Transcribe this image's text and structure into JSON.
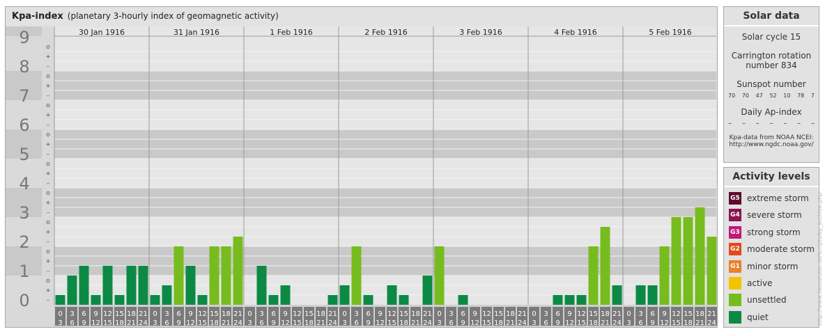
{
  "header": {
    "title": "Kpa-index",
    "subtitle": "(planetary 3-hourly index of geomagnetic activity)"
  },
  "chart_data": {
    "type": "bar",
    "title": "Kpa-index",
    "subtitle": "(planetary 3-hourly index of geomagnetic activity)",
    "ylim": [
      0,
      9
    ],
    "y_major_ticks": [
      "0",
      "1",
      "2",
      "3",
      "4",
      "5",
      "6",
      "7",
      "8",
      "9"
    ],
    "y_minor_ticks": [
      "o",
      "+",
      "–"
    ],
    "days": [
      "30 Jan 1916",
      "31 Jan 1916",
      "1 Feb 1916",
      "2 Feb 1916",
      "3 Feb 1916",
      "4 Feb 1916",
      "5 Feb 1916"
    ],
    "interval_labels": [
      [
        "0",
        "3"
      ],
      [
        "3",
        "6"
      ],
      [
        "6",
        "9"
      ],
      [
        "9",
        "12"
      ],
      [
        "12",
        "15"
      ],
      [
        "15",
        "18"
      ],
      [
        "18",
        "21"
      ],
      [
        "21",
        "24"
      ]
    ],
    "values": [
      [
        0.333,
        1.0,
        1.333,
        0.333,
        1.333,
        0.333,
        1.333,
        1.333
      ],
      [
        0.333,
        0.667,
        2.0,
        1.333,
        0.333,
        2.0,
        2.0,
        2.333
      ],
      [
        0.0,
        1.333,
        0.333,
        0.667,
        0.0,
        0.0,
        0.0,
        0.333
      ],
      [
        0.667,
        2.0,
        0.333,
        0.0,
        0.667,
        0.333,
        0.0,
        1.0
      ],
      [
        2.0,
        0.0,
        0.333,
        0.0,
        0.0,
        0.0,
        0.0,
        0.0
      ],
      [
        0.0,
        0.0,
        0.333,
        0.333,
        0.333,
        2.0,
        2.667,
        0.667
      ],
      [
        0.0,
        0.667,
        0.667,
        2.0,
        3.0,
        3.0,
        3.333,
        2.333
      ]
    ],
    "colors": {
      "quiet": "#0c8a45",
      "unsettled": "#77bc1f"
    },
    "grid": true
  },
  "solar": {
    "title": "Solar data",
    "cycle": "Solar cycle 15",
    "carrington_1": "Carrington rotation",
    "carrington_2": "number 834",
    "sunspot_title": "Sunspot number",
    "sunspots": [
      "70",
      "70",
      "47",
      "52",
      "10",
      "78",
      "7"
    ],
    "ap_title": "Daily Ap-index",
    "ap_values": [
      "–",
      "–",
      "–",
      "–",
      "–",
      "–",
      "–"
    ],
    "source_1": "Kpa-data from NOAA NCEI:",
    "source_2": "http://www.ngdc.noaa.gov/"
  },
  "activity": {
    "title": "Activity levels",
    "levels": [
      {
        "code": "G5",
        "label": "extreme storm",
        "color": "#5c0b2c"
      },
      {
        "code": "G4",
        "label": "severe storm",
        "color": "#8a1550"
      },
      {
        "code": "G3",
        "label": "strong storm",
        "color": "#c2187a"
      },
      {
        "code": "G2",
        "label": "moderate storm",
        "color": "#e04a1e"
      },
      {
        "code": "G1",
        "label": "minor storm",
        "color": "#e8832a"
      },
      {
        "code": "",
        "label": "active",
        "color": "#f5c200"
      },
      {
        "code": "",
        "label": "unsettled",
        "color": "#77bc1f"
      },
      {
        "code": "",
        "label": "quiet",
        "color": "#0c8a45"
      }
    ]
  },
  "watermark": "http://www.tieuxeuter.de/scripts/kp_archive.php"
}
